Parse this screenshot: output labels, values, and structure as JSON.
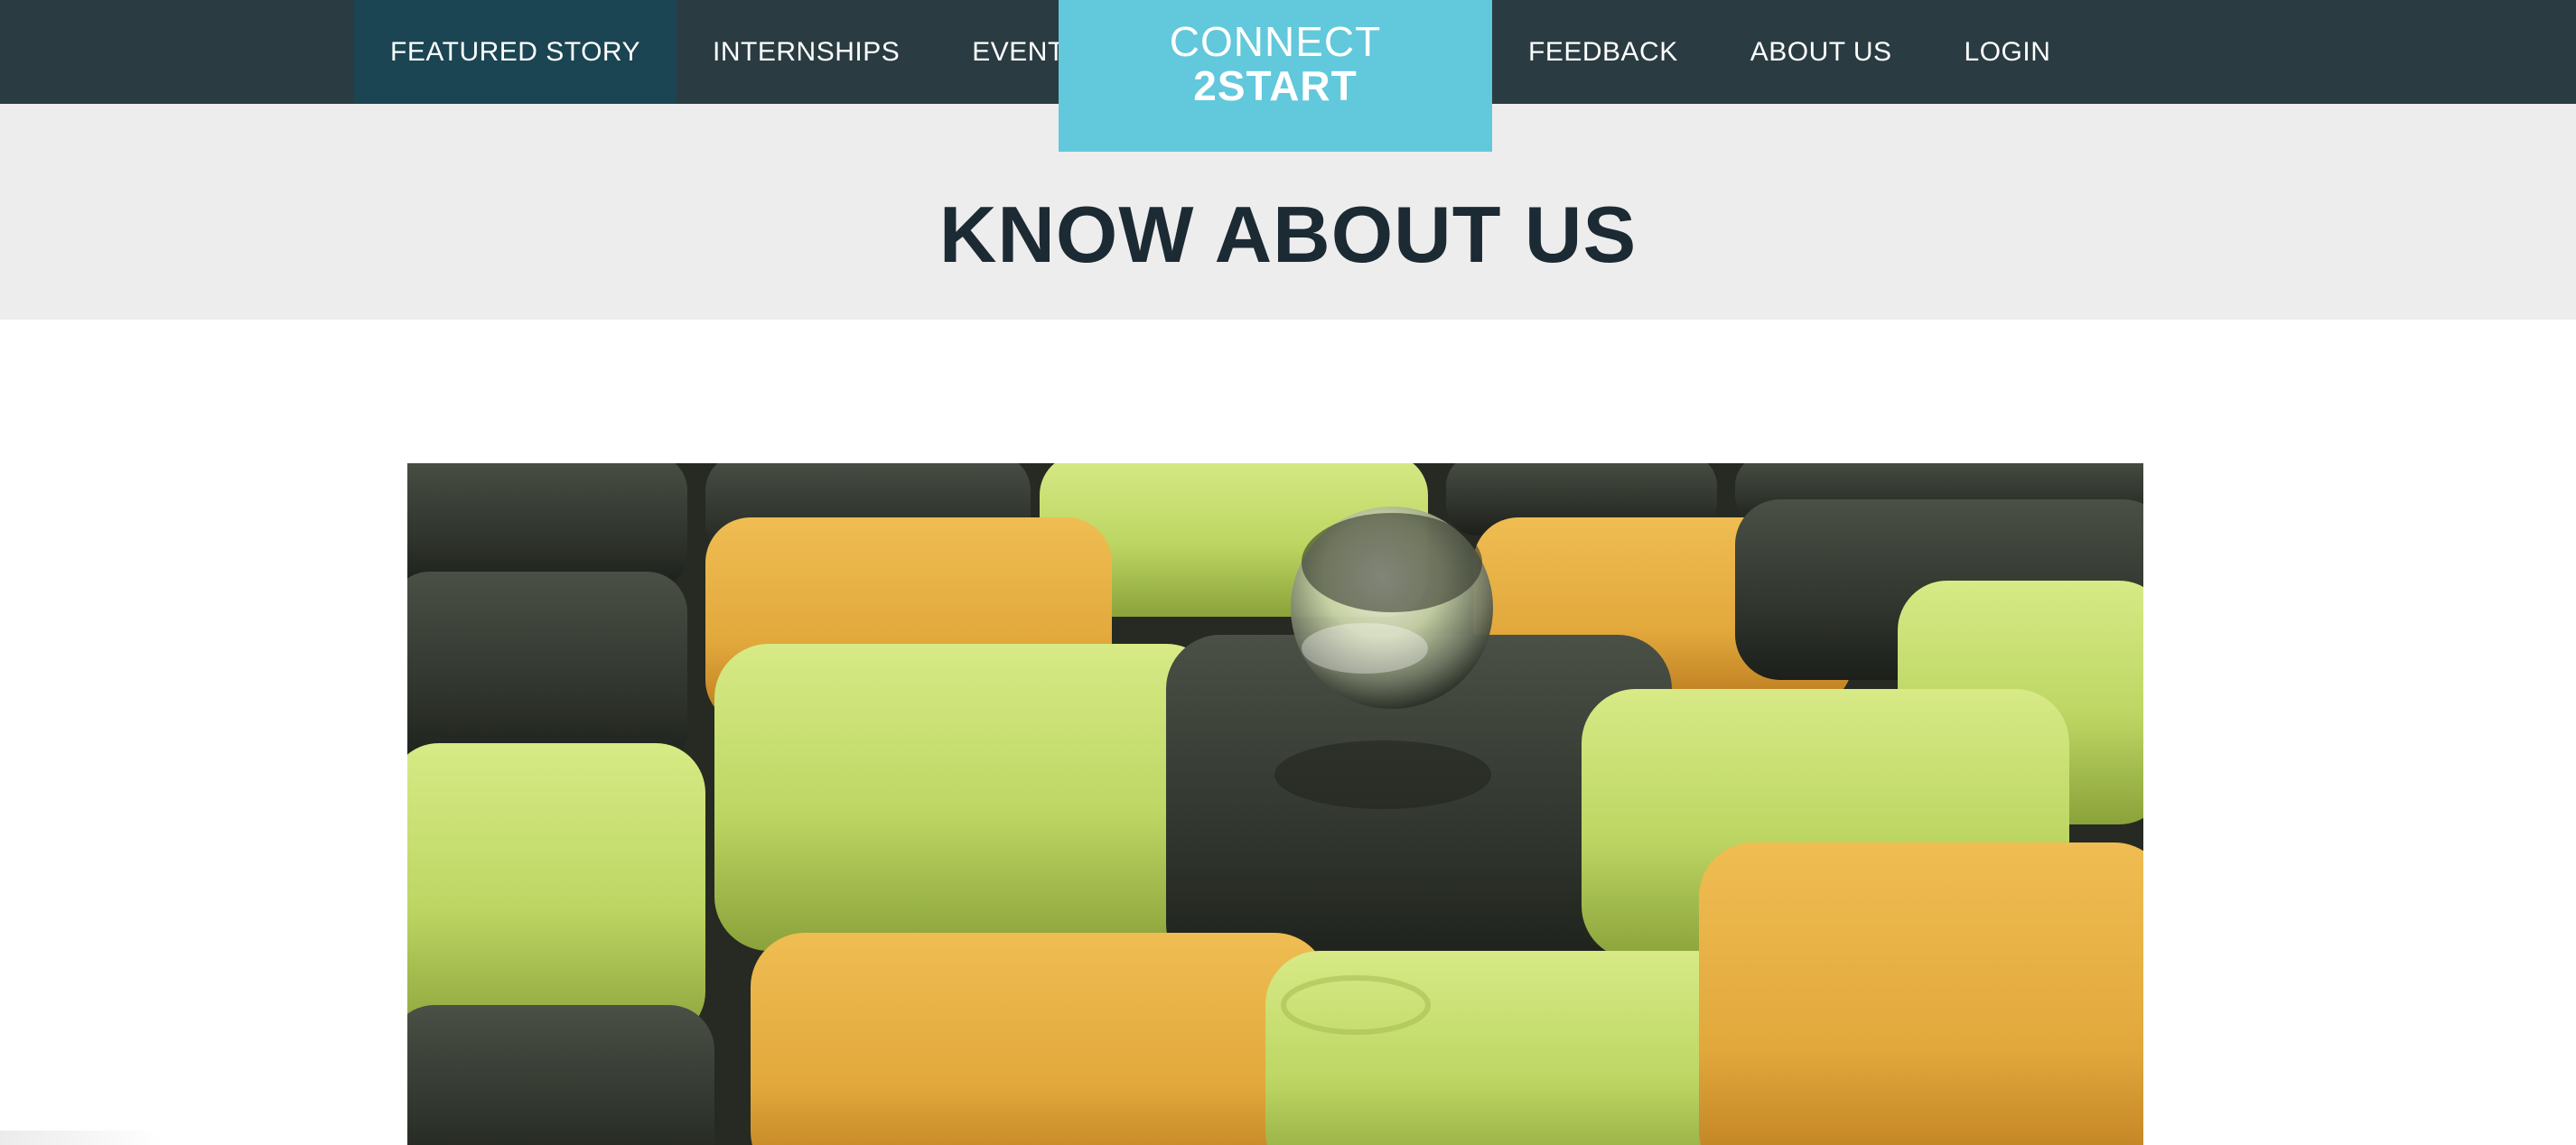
{
  "nav": {
    "left": [
      {
        "label": "FEATURED STORY",
        "active": true
      },
      {
        "label": "INTERNSHIPS",
        "active": false
      },
      {
        "label": "EVENTS",
        "active": false
      }
    ],
    "right": [
      {
        "label": "FEEDBACK",
        "active": false
      },
      {
        "label": "ABOUT US",
        "active": false
      },
      {
        "label": "LOGIN",
        "active": false
      }
    ]
  },
  "logo": {
    "line1": "CONNECT",
    "line2": "2START"
  },
  "hero": {
    "title": "KNOW ABOUT US"
  },
  "colors": {
    "navbar": "#2a3c42",
    "nav_active": "#1b4552",
    "logo_bg": "#62c8dc",
    "hero_bg": "#ededed",
    "title_text": "#1b2a33"
  },
  "image": {
    "subject": "3d-cubes-with-glass-sphere"
  }
}
